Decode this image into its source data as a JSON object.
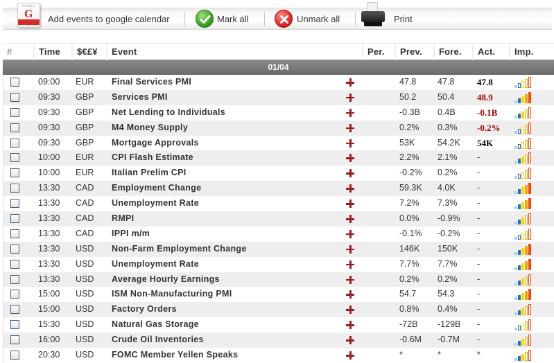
{
  "toolbar": {
    "add_gcal_label": "Add events to google calendar",
    "mark_all_label": "Mark all",
    "unmark_all_label": "Unmark all",
    "print_label": "Print"
  },
  "columns": {
    "num": "#",
    "time": "Time",
    "currency": "$€£¥",
    "event": "Event",
    "period": "Per.",
    "previous": "Prev.",
    "forecast": "Fore.",
    "actual": "Act.",
    "importance": "Imp."
  },
  "date_header": "01/04",
  "colors": {
    "actual_negative": "#a10000",
    "actual_neutral": "#000000",
    "plus_icon": "#9b1c1c",
    "imp_bars": [
      "#9fd4f5",
      "#1e73c4",
      "#ffd500",
      "#ffa200",
      "#f24a0d"
    ]
  },
  "rows": [
    {
      "time": "09:00",
      "currency": "EUR",
      "event": "Final Services PMI",
      "period": "",
      "previous": "47.8",
      "forecast": "47.8",
      "actual": "47.8",
      "actual_tone": "pos",
      "importance": 1
    },
    {
      "time": "09:30",
      "currency": "GBP",
      "event": "Services PMI",
      "period": "",
      "previous": "50.2",
      "forecast": "50.4",
      "actual": "48.9",
      "actual_tone": "neg",
      "importance": 5
    },
    {
      "time": "09:30",
      "currency": "GBP",
      "event": "Net Lending to Individuals",
      "period": "",
      "previous": "-0.3B",
      "forecast": "0.4B",
      "actual": "-0.1B",
      "actual_tone": "neg",
      "importance": 3
    },
    {
      "time": "09:30",
      "currency": "GBP",
      "event": "M4 Money Supply",
      "period": "",
      "previous": "0.2%",
      "forecast": "0.3%",
      "actual": "-0.2%",
      "actual_tone": "neg",
      "importance": 1
    },
    {
      "time": "09:30",
      "currency": "GBP",
      "event": "Mortgage Approvals",
      "period": "",
      "previous": "53K",
      "forecast": "54.2K",
      "actual": "54K",
      "actual_tone": "pos",
      "importance": 1
    },
    {
      "time": "10:00",
      "currency": "EUR",
      "event": "CPI Flash Estimate",
      "period": "",
      "previous": "2.2%",
      "forecast": "2.1%",
      "actual": "-",
      "actual_tone": "none",
      "importance": 3
    },
    {
      "time": "10:00",
      "currency": "EUR",
      "event": "Italian Prelim CPI",
      "period": "",
      "previous": "-0.2%",
      "forecast": "0.2%",
      "actual": "-",
      "actual_tone": "none",
      "importance": 1
    },
    {
      "time": "13:30",
      "currency": "CAD",
      "event": "Employment Change",
      "period": "",
      "previous": "59.3K",
      "forecast": "4.0K",
      "actual": "-",
      "actual_tone": "none",
      "importance": 5
    },
    {
      "time": "13:30",
      "currency": "CAD",
      "event": "Unemployment Rate",
      "period": "",
      "previous": "7.2%",
      "forecast": "7.3%",
      "actual": "-",
      "actual_tone": "none",
      "importance": 5
    },
    {
      "time": "13:30",
      "currency": "CAD",
      "event": "RMPI",
      "period": "",
      "previous": "0.0%",
      "forecast": "-0.9%",
      "actual": "-",
      "actual_tone": "none",
      "importance": 3
    },
    {
      "time": "13:30",
      "currency": "CAD",
      "event": "IPPI m/m",
      "period": "",
      "previous": "-0.1%",
      "forecast": "-0.2%",
      "actual": "-",
      "actual_tone": "none",
      "importance": 1
    },
    {
      "time": "13:30",
      "currency": "USD",
      "event": "Non-Farm Employment Change",
      "period": "",
      "previous": "146K",
      "forecast": "150K",
      "actual": "-",
      "actual_tone": "none",
      "importance": 5
    },
    {
      "time": "13:30",
      "currency": "USD",
      "event": "Unemployment Rate",
      "period": "",
      "previous": "7.7%",
      "forecast": "7.7%",
      "actual": "-",
      "actual_tone": "none",
      "importance": 5
    },
    {
      "time": "13:30",
      "currency": "USD",
      "event": "Average Hourly Earnings",
      "period": "",
      "previous": "0.2%",
      "forecast": "0.2%",
      "actual": "-",
      "actual_tone": "none",
      "importance": 3
    },
    {
      "time": "15:00",
      "currency": "USD",
      "event": "ISM Non-Manufacturing PMI",
      "period": "",
      "previous": "54.7",
      "forecast": "54.3",
      "actual": "-",
      "actual_tone": "none",
      "importance": 5
    },
    {
      "time": "15:00",
      "currency": "USD",
      "event": "Factory Orders",
      "period": "",
      "previous": "0.8%",
      "forecast": "0.4%",
      "actual": "-",
      "actual_tone": "none",
      "importance": 3
    },
    {
      "time": "15:30",
      "currency": "USD",
      "event": "Natural Gas Storage",
      "period": "",
      "previous": "-72B",
      "forecast": "-129B",
      "actual": "-",
      "actual_tone": "none",
      "importance": 1
    },
    {
      "time": "16:00",
      "currency": "USD",
      "event": "Crude Oil Inventories",
      "period": "",
      "previous": "-0.6M",
      "forecast": "-0.7M",
      "actual": "-",
      "actual_tone": "none",
      "importance": 3
    },
    {
      "time": "20:30",
      "currency": "USD",
      "event": "FOMC Member Yellen Speaks",
      "period": "",
      "previous": "*",
      "forecast": "*",
      "actual": "*",
      "actual_tone": "none",
      "importance": 3
    }
  ]
}
